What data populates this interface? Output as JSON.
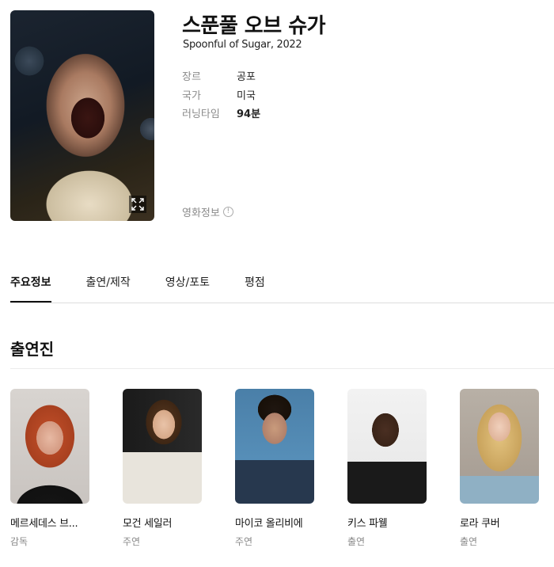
{
  "movie": {
    "title": "스푼풀 오브 슈가",
    "subtitle": "Spoonful of Sugar, 2022",
    "info": [
      {
        "key": "장르",
        "value": "공포"
      },
      {
        "key": "국가",
        "value": "미국"
      },
      {
        "key": "러닝타임",
        "value": "94분"
      }
    ],
    "movie_info_label": "영화정보",
    "info_badge": "!"
  },
  "tabs": [
    {
      "label": "주요정보",
      "active": true
    },
    {
      "label": "출연/제작",
      "active": false
    },
    {
      "label": "영상/포토",
      "active": false
    },
    {
      "label": "평점",
      "active": false
    }
  ],
  "cast_section": {
    "title": "출연진",
    "people": [
      {
        "name": "메르세데스 브...",
        "role": "감독"
      },
      {
        "name": "모건 세일러",
        "role": "주연"
      },
      {
        "name": "마이코 올리비에",
        "role": "주연"
      },
      {
        "name": "키스 파웰",
        "role": "출연"
      },
      {
        "name": "로라 쿠버",
        "role": "출연"
      }
    ]
  },
  "icons": {
    "poster_expand": "expand-icon",
    "info": "info-circle-icon"
  }
}
